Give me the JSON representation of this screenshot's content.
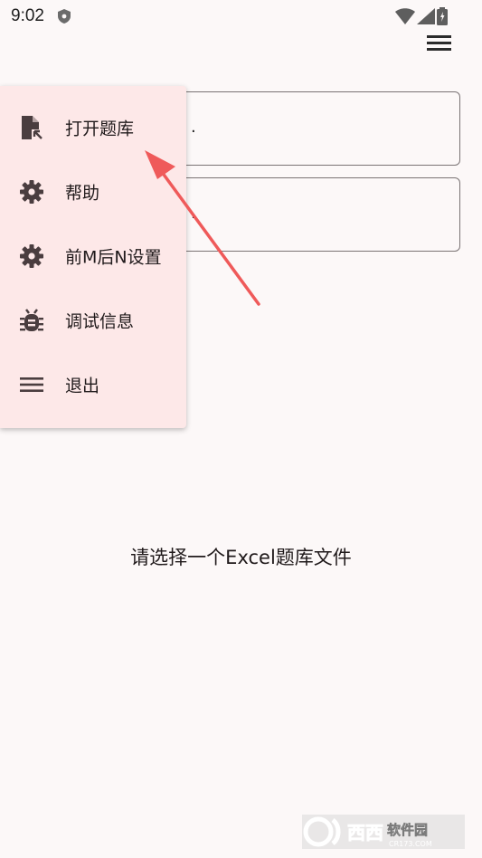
{
  "status_bar": {
    "time": "9:02"
  },
  "fields": [
    {
      "value": "."
    },
    {
      "value": "."
    }
  ],
  "menu": {
    "items": [
      {
        "label": "打开题库",
        "icon": "open-file-icon"
      },
      {
        "label": "帮助",
        "icon": "gear-icon"
      },
      {
        "label": "前M后N设置",
        "icon": "gear-icon"
      },
      {
        "label": "调试信息",
        "icon": "bug-icon"
      },
      {
        "label": "退出",
        "icon": "menu-lines-icon"
      }
    ]
  },
  "main": {
    "empty_message": "请选择一个Excel题库文件"
  },
  "watermark": {
    "text": "西西软件园",
    "site": "CR173.COM"
  },
  "colors": {
    "menu_background": "#fde8e8",
    "annotation_arrow": "#ef5a5a",
    "page_background": "#fcf8f8"
  }
}
